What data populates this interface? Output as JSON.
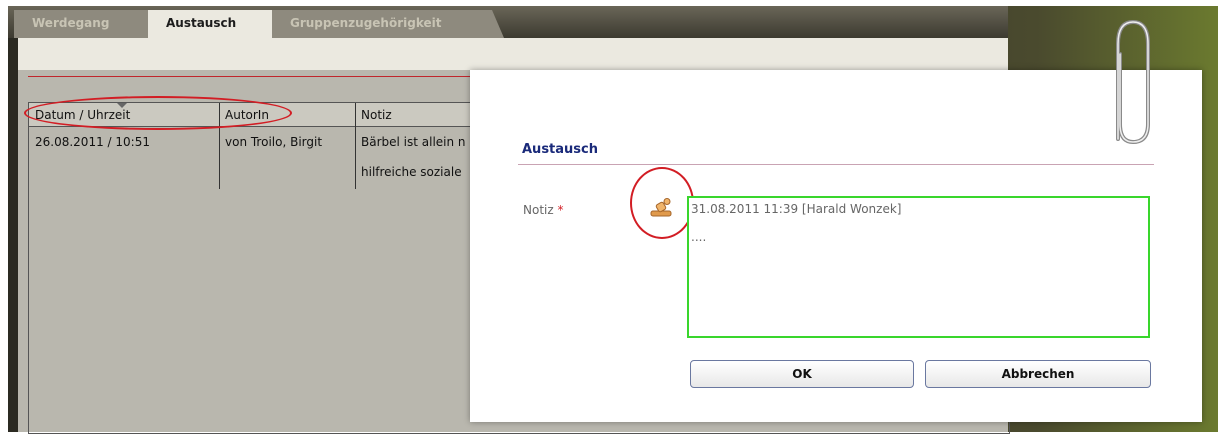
{
  "tabs": [
    {
      "label": "Werdegang",
      "active": false
    },
    {
      "label": "Austausch",
      "active": true
    },
    {
      "label": "Gruppenzugehörigkeit",
      "active": false
    }
  ],
  "table": {
    "columns": [
      "Datum / Uhrzeit",
      "AutorIn",
      "Notiz"
    ],
    "rows": [
      {
        "datum": "26.08.2011 / 10:51",
        "autor": "von Troilo, Birgit",
        "notiz_line1": "Bärbel ist allein n",
        "notiz_line2": "hilfreiche soziale"
      }
    ]
  },
  "dialog": {
    "title": "Austausch",
    "note_label": "Notiz",
    "required_marker": "*",
    "note_value": "31.08.2011 11:39 [Harald Wonzek]\n\n....",
    "ok_label": "OK",
    "cancel_label": "Abbrechen",
    "stamp_icon": "stamp-icon"
  },
  "colors": {
    "accent_red": "#d21d24",
    "title_blue": "#1a2a7a",
    "field_border_green": "#39d62c"
  }
}
